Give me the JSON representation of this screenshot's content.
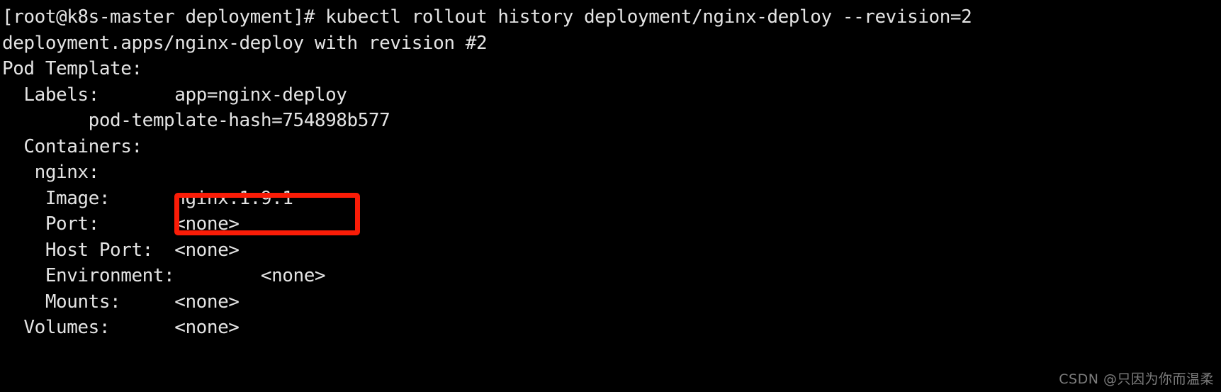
{
  "terminal": {
    "shell_prompt": "[root@k8s-master deployment]# ",
    "command": "kubectl rollout history deployment/nginx-deploy --revision=2",
    "prompt_line": "[root@k8s-master deployment]# kubectl rollout history deployment/nginx-deploy --revision=2",
    "background_color": "#000000",
    "text_color": "#e4e4e4",
    "lines": [
      "[root@k8s-master deployment]# kubectl rollout history deployment/nginx-deploy --revision=2",
      "deployment.apps/nginx-deploy with revision #2",
      "Pod Template:",
      "  Labels:       app=nginx-deploy",
      "        pod-template-hash=754898b577",
      "  Containers:",
      "   nginx:",
      "    Image:      nginx:1.9.1",
      "    Port:       <none>",
      "    Host Port:  <none>",
      "    Environment:        <none>",
      "    Mounts:     <none>",
      "  Volumes:      <none>"
    ]
  },
  "output": {
    "deployment_header": "deployment.apps/nginx-deploy with revision #2",
    "pod_template_label": "Pod Template:",
    "labels_key": "Labels:",
    "labels_app": "app=nginx-deploy",
    "labels_pod_template_hash": "pod-template-hash=754898b577",
    "containers_key": "Containers:",
    "container_name": "nginx:",
    "image_key": "Image:",
    "image_value": "nginx:1.9.1",
    "port_key": "Port:",
    "port_value": "<none>",
    "host_port_key": "Host Port:",
    "host_port_value": "<none>",
    "environment_key": "Environment:",
    "environment_value": "<none>",
    "mounts_key": "Mounts:",
    "mounts_value": "<none>",
    "volumes_key": "Volumes:",
    "volumes_value": "<none>"
  },
  "annotation": {
    "highlight_target": "nginx:1.9.1",
    "highlight_color": "#fa1c07"
  },
  "watermark": {
    "text": "CSDN @只因为你而温柔",
    "color": "#7d7d7d"
  }
}
